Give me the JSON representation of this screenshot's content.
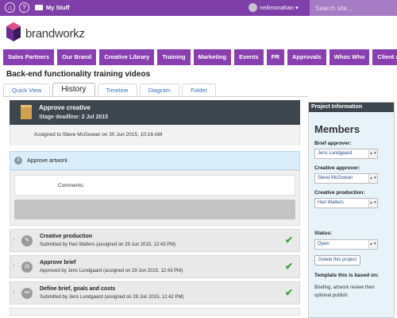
{
  "topbar": {
    "home_icon": "home-icon",
    "help_icon": "question-icon",
    "my_stuff_label": "My Stuff",
    "user_name": "neilmonahan",
    "search_placeholder": "Search site..."
  },
  "logo": {
    "wordmark": "brandworkz"
  },
  "nav": {
    "items": [
      "Sales Partners",
      "Our Brand",
      "Creative Library",
      "Training",
      "Marketing",
      "Events",
      "PR",
      "Approvals",
      "Whos Who",
      "Client area"
    ]
  },
  "page": {
    "title": "Back-end functionality training videos"
  },
  "tabs": [
    "Quick View",
    "History",
    "Timeline",
    "Diagram",
    "Folder"
  ],
  "active_tab": "History",
  "history": {
    "stage_title": "Approve creative",
    "stage_deadline": "Stage deadline: 2 Jul 2015",
    "assigned_text": "Assigned to Steve McGowan on 30 Jun 2015, 10:16 AM",
    "current_action": "Approve artwork",
    "comments_label": "Comments:",
    "entries": [
      {
        "title": "Creative production",
        "detail": "Submitted by Hari Walters (assigned on 29 Jun 2015, 12:43 PM)"
      },
      {
        "title": "Approve brief",
        "detail": "Approved by Jens Lundgaard (assigned on 29 Jun 2015, 12:43 PM)"
      },
      {
        "title": "Define brief, goals and costs",
        "detail": "Submitted by Jens Lundgaard (assigned on 29 Jun 2015, 12:42 PM)"
      }
    ]
  },
  "project_info": {
    "header": "Project Information",
    "members_heading": "Members",
    "fields": [
      {
        "label": "Brief approver:",
        "value": "Jens Lundgaard"
      },
      {
        "label": "Creative approver:",
        "value": "Steve McGowan"
      },
      {
        "label": "Creative production:",
        "value": "Hari Walters"
      }
    ],
    "status_label": "Status:",
    "status_value": "Open",
    "delete_button": "Delete this project",
    "template_label": "Template this is based on:",
    "template_text": "Briefing, artwork review then optional publish"
  },
  "colors": {
    "brand_purple": "#7f3fa8",
    "nav_purple": "#8a3fb0",
    "dark_header": "#3d464e",
    "check_green": "#3aa53a",
    "link_blue": "#3573b9"
  }
}
